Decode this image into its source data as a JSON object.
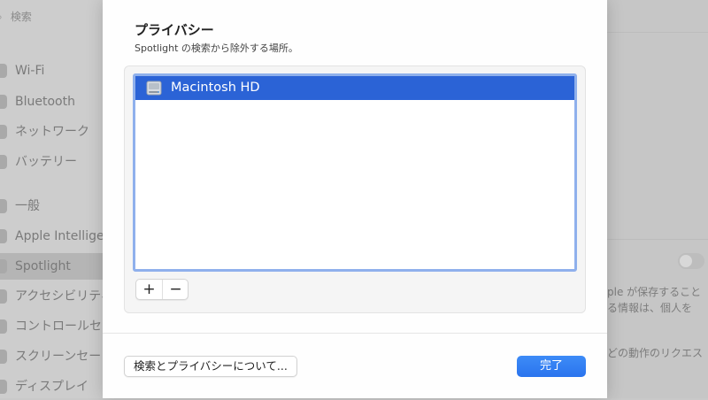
{
  "background": {
    "search_placeholder": "検索",
    "sidebar_items": [
      {
        "label": "Wi-Fi",
        "icon": "wifi-icon"
      },
      {
        "label": "Bluetooth",
        "icon": "bluetooth-icon"
      },
      {
        "label": "ネットワーク",
        "icon": "network-icon"
      },
      {
        "label": "バッテリー",
        "icon": "battery-icon"
      },
      {
        "label": "一般",
        "icon": "gear-icon"
      },
      {
        "label": "Apple Intellige",
        "icon": "apple-intelligence-icon"
      },
      {
        "label": "Spotlight",
        "icon": "spotlight-icon"
      },
      {
        "label": "アクセシビリティ",
        "icon": "accessibility-icon"
      },
      {
        "label": "コントロールセ",
        "icon": "control-center-icon"
      },
      {
        "label": "スクリーンセー",
        "icon": "screensaver-icon"
      },
      {
        "label": "ディスプレイ",
        "icon": "display-icon"
      }
    ],
    "right_text_1": "ple が保存すること",
    "right_text_2": "る情報は、個人を",
    "right_text_3": "どの動作のリクエス"
  },
  "sheet": {
    "title": "プライバシー",
    "subtitle": "Spotlight の検索から除外する場所。",
    "list_items": [
      {
        "label": "Macintosh HD",
        "icon": "hard-disk-icon",
        "selected": true
      }
    ],
    "add_label": "+",
    "remove_label": "−",
    "about_button_label": "検索とプライバシーについて...",
    "done_button_label": "完了"
  },
  "colors": {
    "accent": "#2b63d6",
    "primary_button": "#2f7cf2",
    "list_focus_ring": "#8fb0ec"
  }
}
